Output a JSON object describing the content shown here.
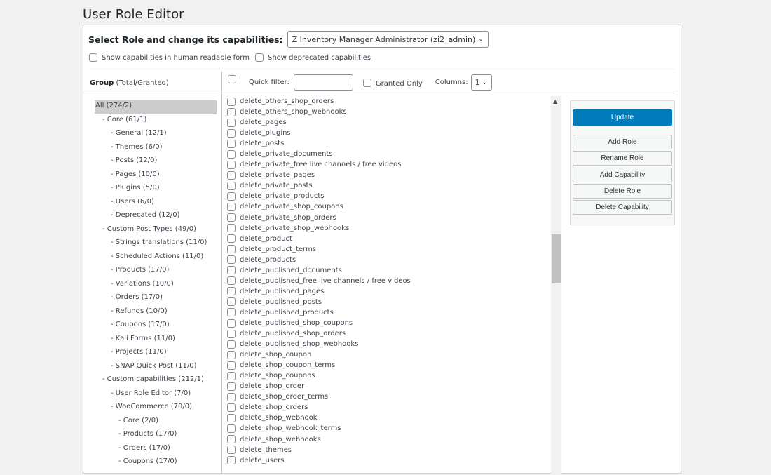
{
  "page_title": "User Role Editor",
  "role_select": {
    "label": "Select Role and change its capabilities:",
    "value": "Z Inventory Manager Administrator (zi2_admin)"
  },
  "options": {
    "human_readable": "Show capabilities in human readable form",
    "deprecated": "Show deprecated capabilities"
  },
  "group_header": {
    "bold": "Group",
    "rest": "(Total/Granted)"
  },
  "toolbar": {
    "quick_filter": "Quick filter:",
    "granted_only": "Granted Only",
    "columns_label": "Columns:",
    "columns_value": "1"
  },
  "groups": [
    {
      "label": "All (274/2)",
      "level": 0
    },
    {
      "label": "- Core (61/1)",
      "level": 1
    },
    {
      "label": "- General (12/1)",
      "level": 2
    },
    {
      "label": "- Themes (6/0)",
      "level": 2
    },
    {
      "label": "- Posts (12/0)",
      "level": 2
    },
    {
      "label": "- Pages (10/0)",
      "level": 2
    },
    {
      "label": "- Plugins (5/0)",
      "level": 2
    },
    {
      "label": "- Users (6/0)",
      "level": 2
    },
    {
      "label": "- Deprecated (12/0)",
      "level": 2
    },
    {
      "label": "- Custom Post Types (49/0)",
      "level": 1
    },
    {
      "label": "- Strings translations (11/0)",
      "level": 2
    },
    {
      "label": "- Scheduled Actions (11/0)",
      "level": 2
    },
    {
      "label": "- Products (17/0)",
      "level": 2
    },
    {
      "label": "- Variations (10/0)",
      "level": 2
    },
    {
      "label": "- Orders (17/0)",
      "level": 2
    },
    {
      "label": "- Refunds (10/0)",
      "level": 2
    },
    {
      "label": "- Coupons (17/0)",
      "level": 2
    },
    {
      "label": "- Kali Forms (11/0)",
      "level": 2
    },
    {
      "label": "- Projects (11/0)",
      "level": 2
    },
    {
      "label": "- SNAP Quick Post (11/0)",
      "level": 2
    },
    {
      "label": "- Custom capabilities (212/1)",
      "level": 1
    },
    {
      "label": "- User Role Editor (7/0)",
      "level": 2
    },
    {
      "label": "- WooCommerce (70/0)",
      "level": 2
    },
    {
      "label": "- Core (2/0)",
      "level": 3
    },
    {
      "label": "- Products (17/0)",
      "level": 3
    },
    {
      "label": "- Orders (17/0)",
      "level": 3
    },
    {
      "label": "- Coupons (17/0)",
      "level": 3
    }
  ],
  "capabilities": [
    "delete_others_shop_orders",
    "delete_others_shop_webhooks",
    "delete_pages",
    "delete_plugins",
    "delete_posts",
    "delete_private_documents",
    "delete_private_free live channels / free videos",
    "delete_private_pages",
    "delete_private_posts",
    "delete_private_products",
    "delete_private_shop_coupons",
    "delete_private_shop_orders",
    "delete_private_shop_webhooks",
    "delete_product",
    "delete_product_terms",
    "delete_products",
    "delete_published_documents",
    "delete_published_free live channels / free videos",
    "delete_published_pages",
    "delete_published_posts",
    "delete_published_products",
    "delete_published_shop_coupons",
    "delete_published_shop_orders",
    "delete_published_shop_webhooks",
    "delete_shop_coupon",
    "delete_shop_coupon_terms",
    "delete_shop_coupons",
    "delete_shop_order",
    "delete_shop_order_terms",
    "delete_shop_orders",
    "delete_shop_webhook",
    "delete_shop_webhook_terms",
    "delete_shop_webhooks",
    "delete_themes",
    "delete_users"
  ],
  "actions": {
    "update": "Update",
    "add_role": "Add Role",
    "rename_role": "Rename Role",
    "add_capability": "Add Capability",
    "delete_role": "Delete Role",
    "delete_capability": "Delete Capability"
  },
  "colors": {
    "primary": "#007cba",
    "selected_group": "#cccccc"
  }
}
